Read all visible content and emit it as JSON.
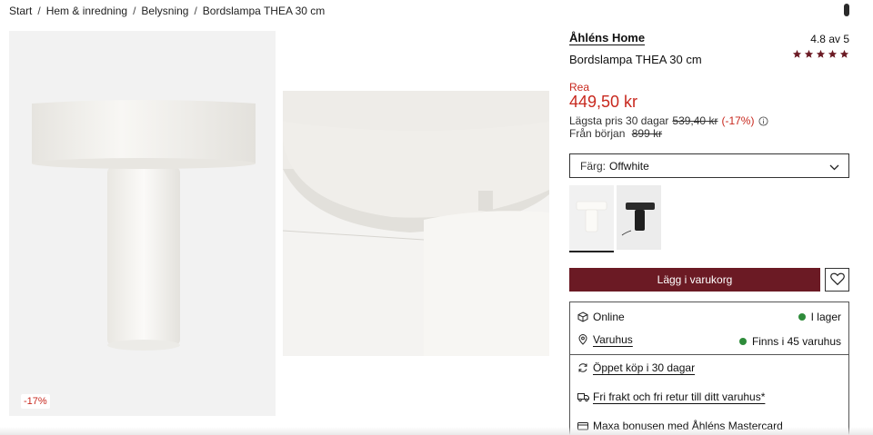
{
  "breadcrumb": {
    "items": [
      "Start",
      "Hem & inredning",
      "Belysning",
      "Bordslampa THEA 30 cm"
    ],
    "separator": "/"
  },
  "gallery": {
    "sale_badge": "-17%",
    "image_left": "white table lamp with wide round shade",
    "image_right": "close-up of white lamp shade and stem"
  },
  "product": {
    "brand": "Åhléns Home",
    "rating_text": "4.8 av 5",
    "rating_stars": 5,
    "title": "Bordslampa THEA 30 cm",
    "sale_label": "Rea",
    "price": "449,50 kr",
    "lowest_price_label": "Lägsta pris 30 dagar",
    "lowest_price_value": "539,40 kr",
    "lowest_price_pct": "(-17%)",
    "original_label": "Från början",
    "original_price": "899 kr"
  },
  "color": {
    "label": "Färg:",
    "value": "Offwhite",
    "swatches": [
      "offwhite",
      "black"
    ]
  },
  "actions": {
    "add_to_cart": "Lägg i varukorg",
    "wishlist_icon": "heart-icon"
  },
  "stock": {
    "online_label": "Online",
    "online_status": "I lager",
    "store_label": "Varuhus",
    "store_status": "Finns i 45 varuhus"
  },
  "perks": {
    "returns": "Öppet köp i 30 dagar",
    "shipping": "Fri frakt och fri retur till ditt varuhus*",
    "card": "Maxa bonusen med Åhléns Mastercard"
  },
  "colors": {
    "sale_red": "#c8281e",
    "button_bg": "#6b1a24",
    "star": "#6b1a24",
    "in_stock": "#2e8b3a"
  }
}
